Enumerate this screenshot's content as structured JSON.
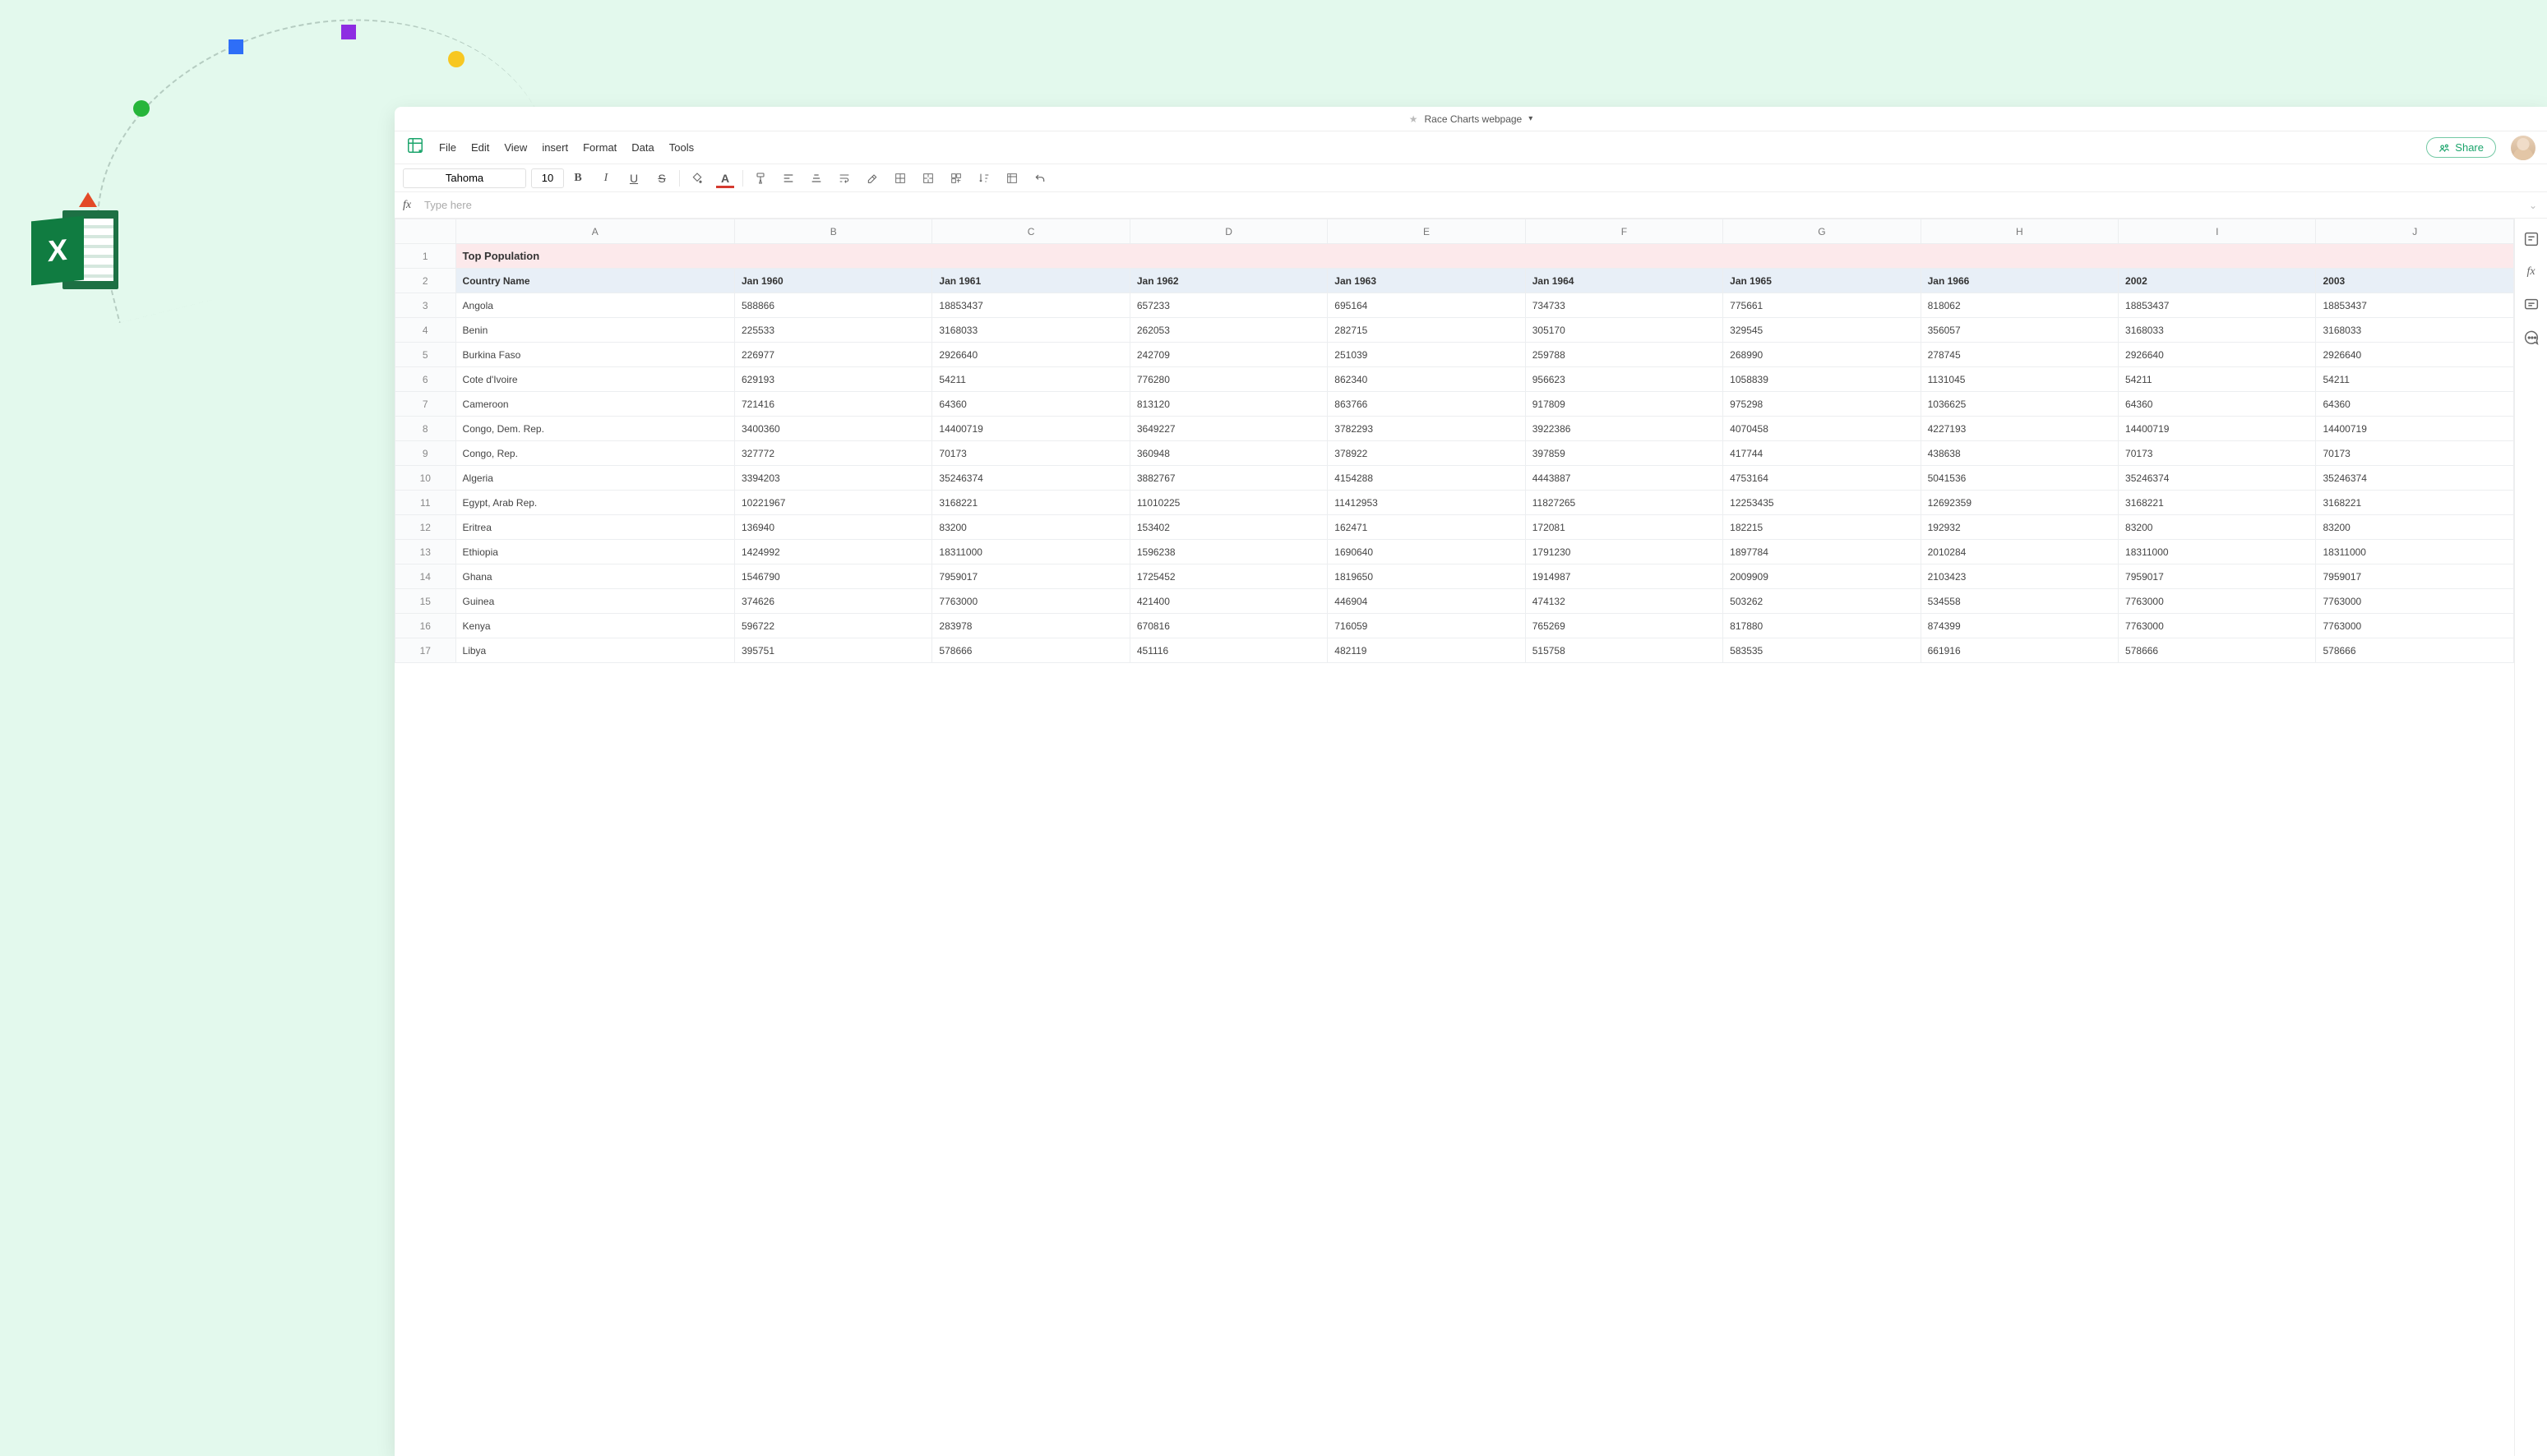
{
  "title": "Race Charts webpage",
  "menus": [
    "File",
    "Edit",
    "View",
    "insert",
    "Format",
    "Data",
    "Tools"
  ],
  "share": "Share",
  "font": {
    "name": "Tahoma",
    "size": "10"
  },
  "formula_placeholder": "Type here",
  "columns": [
    "A",
    "B",
    "C",
    "D",
    "E",
    "F",
    "G",
    "H",
    "I",
    "J"
  ],
  "row1_label": "Top Population",
  "headers": [
    "Country Name",
    "Jan 1960",
    "Jan 1961",
    "Jan 1962",
    "Jan 1963",
    "Jan 1964",
    "Jan 1965",
    "Jan 1966",
    "2002",
    "2003"
  ],
  "rows": [
    {
      "n": "3",
      "c": [
        "Angola",
        "588866",
        "18853437",
        "657233",
        "695164",
        "734733",
        "775661",
        "818062",
        "18853437",
        "18853437"
      ]
    },
    {
      "n": "4",
      "c": [
        "Benin",
        "225533",
        "3168033",
        "262053",
        "282715",
        "305170",
        "329545",
        "356057",
        "3168033",
        "3168033"
      ]
    },
    {
      "n": "5",
      "c": [
        "Burkina Faso",
        "226977",
        "2926640",
        "242709",
        "251039",
        "259788",
        "268990",
        "278745",
        "2926640",
        "2926640"
      ]
    },
    {
      "n": "6",
      "c": [
        "Cote d'Ivoire",
        "629193",
        "54211",
        "776280",
        "862340",
        "956623",
        "1058839",
        "1131045",
        "54211",
        "54211"
      ]
    },
    {
      "n": "7",
      "c": [
        "Cameroon",
        "721416",
        "64360",
        "813120",
        "863766",
        "917809",
        "975298",
        "1036625",
        "64360",
        "64360"
      ]
    },
    {
      "n": "8",
      "c": [
        "Congo, Dem. Rep.",
        "3400360",
        "14400719",
        "3649227",
        "3782293",
        "3922386",
        "4070458",
        "4227193",
        "14400719",
        "14400719"
      ]
    },
    {
      "n": "9",
      "c": [
        "Congo, Rep.",
        "327772",
        "70173",
        "360948",
        "378922",
        "397859",
        "417744",
        "438638",
        "70173",
        "70173"
      ]
    },
    {
      "n": "10",
      "c": [
        "Algeria",
        "3394203",
        "35246374",
        "3882767",
        "4154288",
        "4443887",
        "4753164",
        "5041536",
        "35246374",
        "35246374"
      ]
    },
    {
      "n": "11",
      "c": [
        "Egypt, Arab Rep.",
        "10221967",
        "3168221",
        "11010225",
        "11412953",
        "11827265",
        "12253435",
        "12692359",
        "3168221",
        "3168221"
      ]
    },
    {
      "n": "12",
      "c": [
        "Eritrea",
        "136940",
        "83200",
        "153402",
        "162471",
        "172081",
        "182215",
        "192932",
        "83200",
        "83200"
      ]
    },
    {
      "n": "13",
      "c": [
        "Ethiopia",
        "1424992",
        "18311000",
        "1596238",
        "1690640",
        "1791230",
        "1897784",
        "2010284",
        "18311000",
        "18311000"
      ]
    },
    {
      "n": "14",
      "c": [
        "Ghana",
        "1546790",
        "7959017",
        "1725452",
        "1819650",
        "1914987",
        "2009909",
        "2103423",
        "7959017",
        "7959017"
      ]
    },
    {
      "n": "15",
      "c": [
        "Guinea",
        "374626",
        "7763000",
        "421400",
        "446904",
        "474132",
        "503262",
        "534558",
        "7763000",
        "7763000"
      ]
    },
    {
      "n": "16",
      "c": [
        "Kenya",
        "596722",
        "283978",
        "670816",
        "716059",
        "765269",
        "817880",
        "874399",
        "7763000",
        "7763000"
      ]
    },
    {
      "n": "17",
      "c": [
        "Libya",
        "395751",
        "578666",
        "451116",
        "482119",
        "515758",
        "583535",
        "661916",
        "578666",
        "578666"
      ]
    }
  ]
}
